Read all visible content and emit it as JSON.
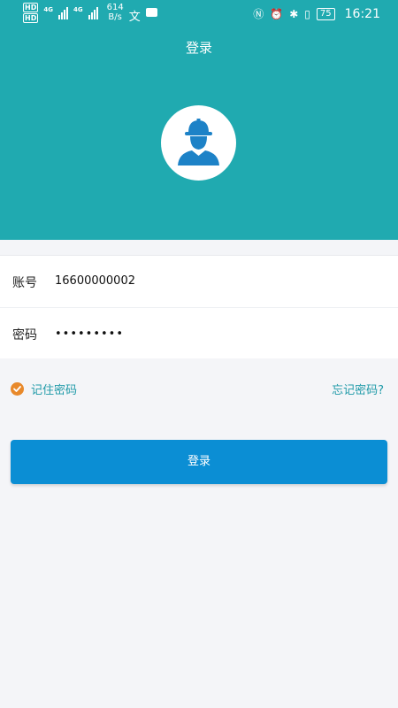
{
  "status_bar": {
    "hd1": "HD",
    "hd2": "HD",
    "net1": "4G",
    "net2": "4G",
    "speed_value": "614",
    "speed_unit": "B/s",
    "battery": "75",
    "time": "16:21"
  },
  "header": {
    "title": "登录",
    "background_color": "#20aab0"
  },
  "form": {
    "account_label": "账号",
    "account_value": "16600000002",
    "password_label": "密码",
    "password_value": "•••••••••"
  },
  "options": {
    "remember_label": "记住密码",
    "remember_checked": true,
    "forgot_label": "忘记密码?"
  },
  "login_button": {
    "label": "登录",
    "color": "#0b8ed4"
  }
}
